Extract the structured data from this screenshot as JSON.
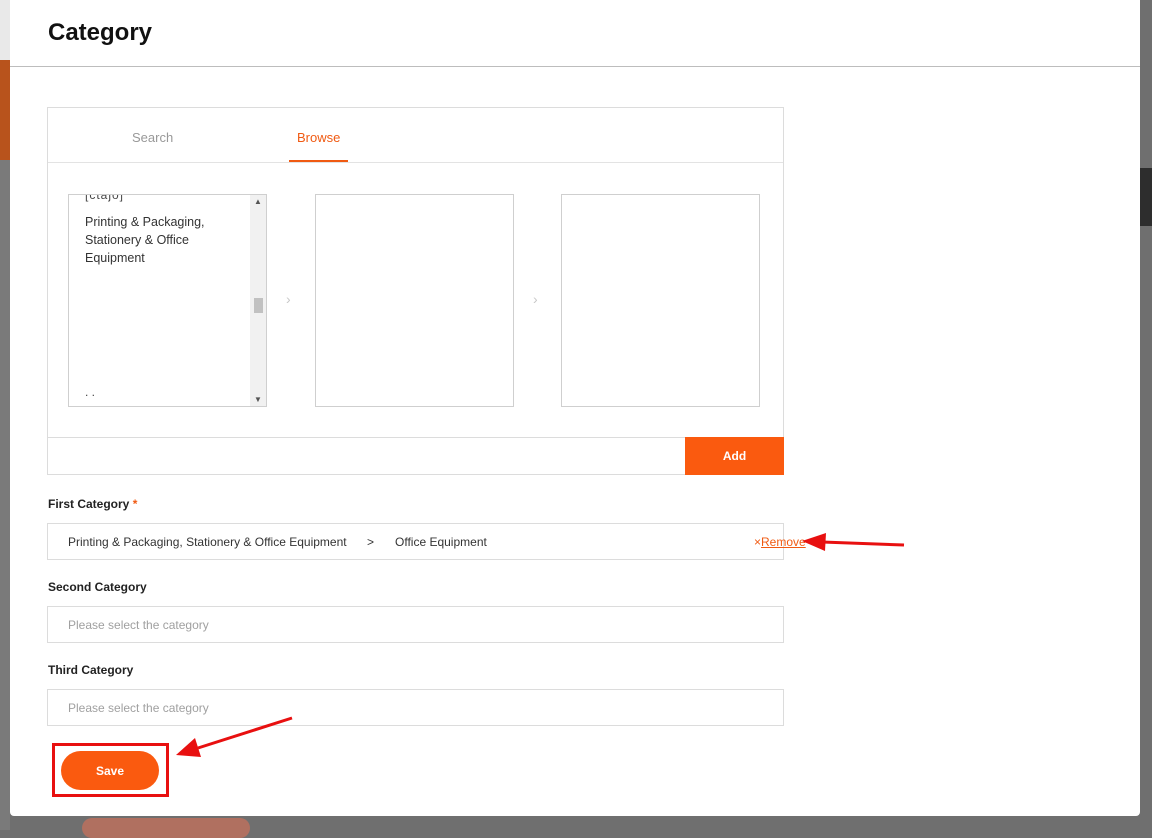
{
  "modal": {
    "title": "Category"
  },
  "tabs": {
    "search_label": "Search",
    "browse_label": "Browse",
    "active": "Browse"
  },
  "browse": {
    "column1": {
      "clipped_top_text": "[ctajo]",
      "clipped_bottom_text": ". .",
      "items": [
        "Printing & Packaging, Stationery & Office Equipment"
      ]
    },
    "column2": {
      "items": []
    },
    "column3": {
      "items": []
    },
    "chevron": "›",
    "add_label": "Add"
  },
  "first_category": {
    "label": "First Category",
    "required_mark": "*",
    "path_parent": "Printing & Packaging, Stationery & Office Equipment",
    "path_separator": ">",
    "path_child": "Office Equipment",
    "remove_icon": "×",
    "remove_label": "Remove"
  },
  "second_category": {
    "label": "Second Category",
    "placeholder": "Please select the category",
    "value": ""
  },
  "third_category": {
    "label": "Third Category",
    "placeholder": "Please select the category",
    "value": ""
  },
  "save_label": "Save",
  "colors": {
    "accent": "#fa5a0f",
    "annotation_red": "#e81010"
  }
}
